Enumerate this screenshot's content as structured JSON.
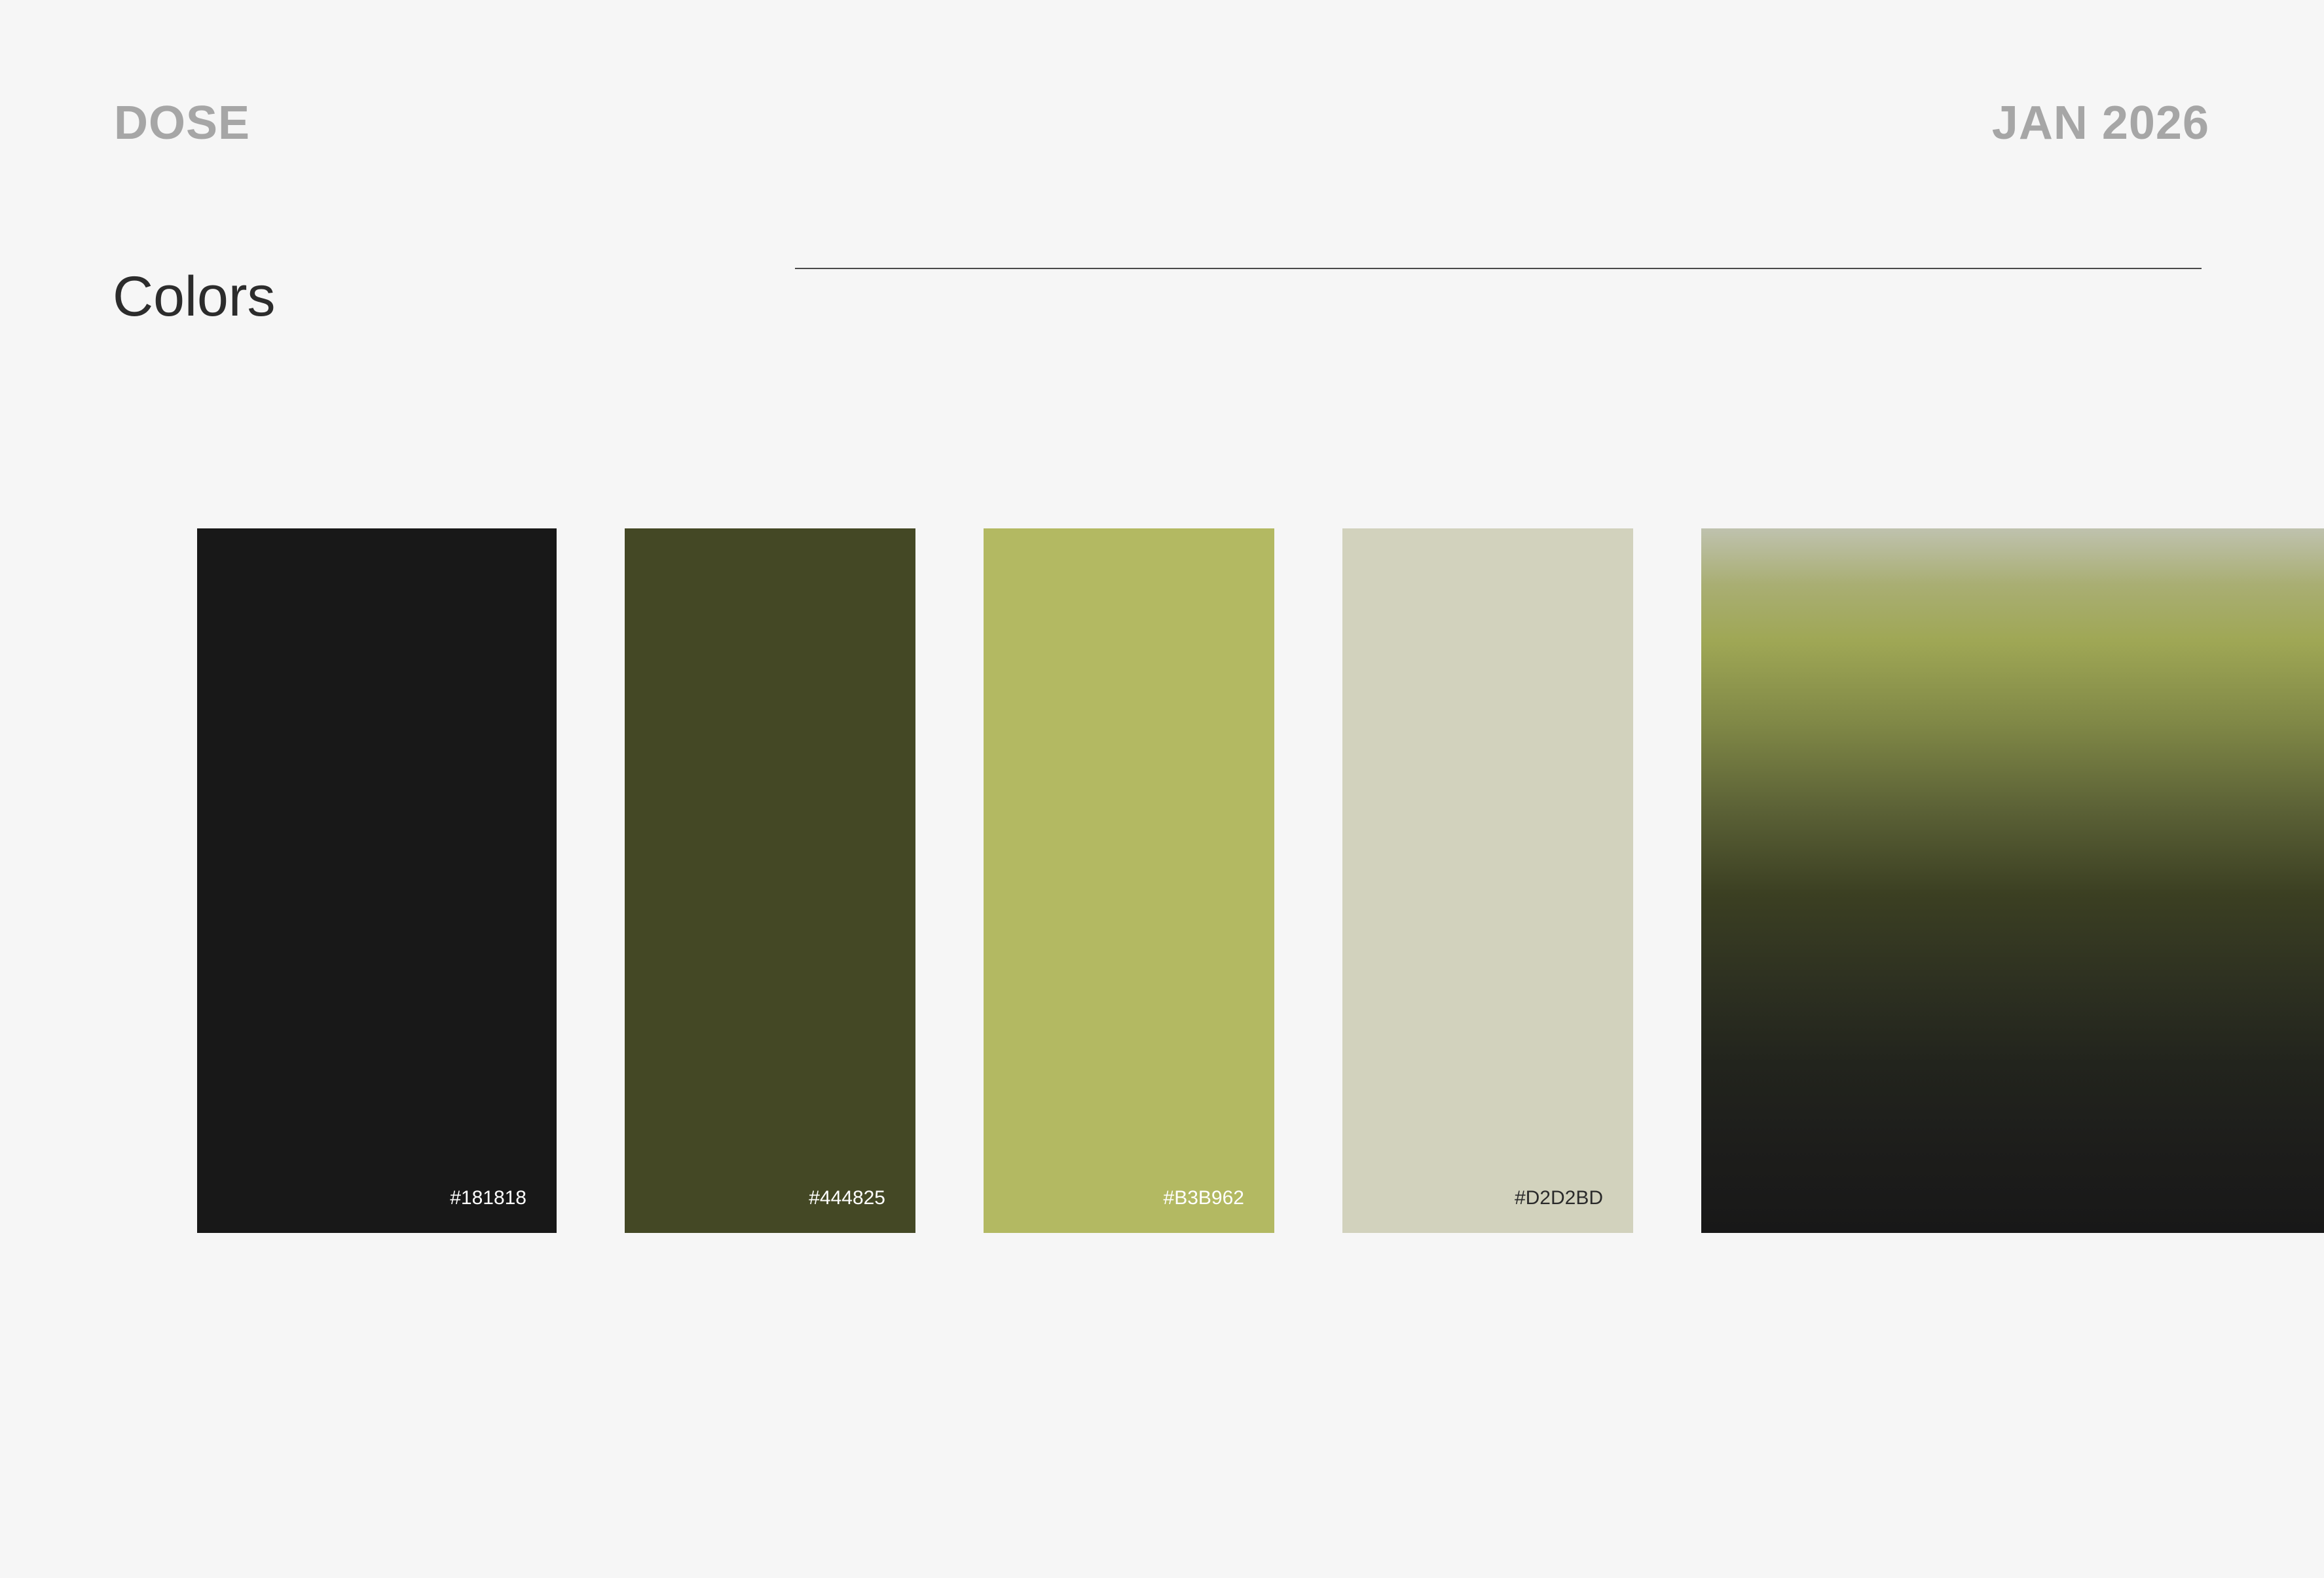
{
  "header": {
    "brand": "DOSE",
    "date": "JAN 2026"
  },
  "page": {
    "title": "Colors"
  },
  "swatches": [
    {
      "code": "#181818",
      "color": "#181818",
      "text_color": "#ffffff"
    },
    {
      "code": "#444825",
      "color": "#444825",
      "text_color": "#ffffff"
    },
    {
      "code": "#B3B962",
      "color": "#B3B962",
      "text_color": "#ffffff"
    },
    {
      "code": "#D2D2BD",
      "color": "#D2D2BD",
      "text_color": "#2b2b2b"
    }
  ],
  "gradient": {
    "stops": [
      "#bfc2ae",
      "#9fa755",
      "#3b3f22",
      "#181818"
    ]
  }
}
